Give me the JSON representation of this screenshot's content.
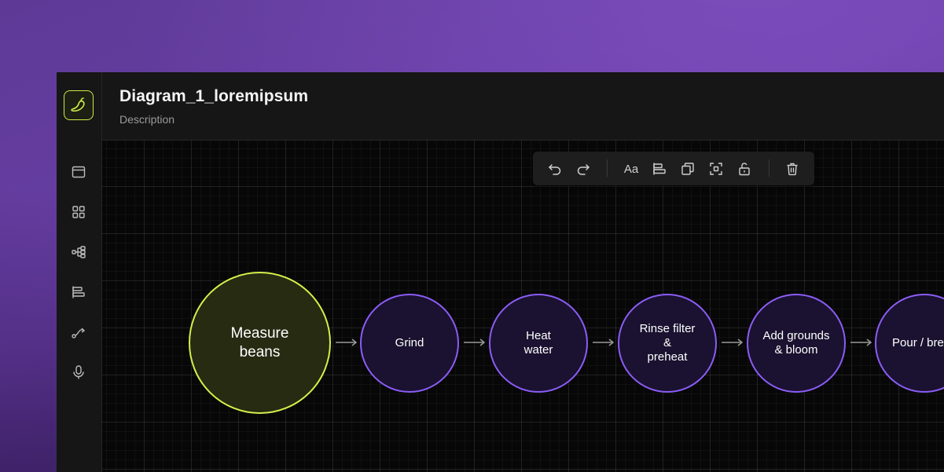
{
  "header": {
    "title": "Diagram_1_loremipsum",
    "description": "Description"
  },
  "sidebar": {
    "logo_icon": "chili-pepper-icon",
    "items": [
      {
        "icon": "window-icon"
      },
      {
        "icon": "grid-icon"
      },
      {
        "icon": "hierarchy-icon"
      },
      {
        "icon": "align-bars-icon"
      },
      {
        "icon": "path-curve-icon"
      },
      {
        "icon": "microphone-icon"
      }
    ]
  },
  "toolbar": {
    "items": [
      {
        "icon": "undo-icon"
      },
      {
        "icon": "redo-icon"
      },
      {
        "icon": "text-format-icon",
        "label": "Aa"
      },
      {
        "icon": "align-left-icon"
      },
      {
        "icon": "duplicate-icon"
      },
      {
        "icon": "select-frame-icon"
      },
      {
        "icon": "unlock-icon"
      },
      {
        "icon": "trash-icon"
      }
    ]
  },
  "diagram": {
    "nodes": [
      {
        "label": "Measure\nbeans",
        "style": "highlight"
      },
      {
        "label": "Grind"
      },
      {
        "label": "Heat\nwater"
      },
      {
        "label": "Rinse filter\n&\npreheat"
      },
      {
        "label": "Add grounds\n& bloom"
      },
      {
        "label": "Pour / bre"
      }
    ],
    "colors": {
      "highlight_border": "#d4f04a",
      "node_border": "#8b5cf6",
      "arrow": "#9a9a9a"
    }
  },
  "colors": {
    "accent": "#cde94a",
    "background_gradient": "#6a3fa8"
  }
}
